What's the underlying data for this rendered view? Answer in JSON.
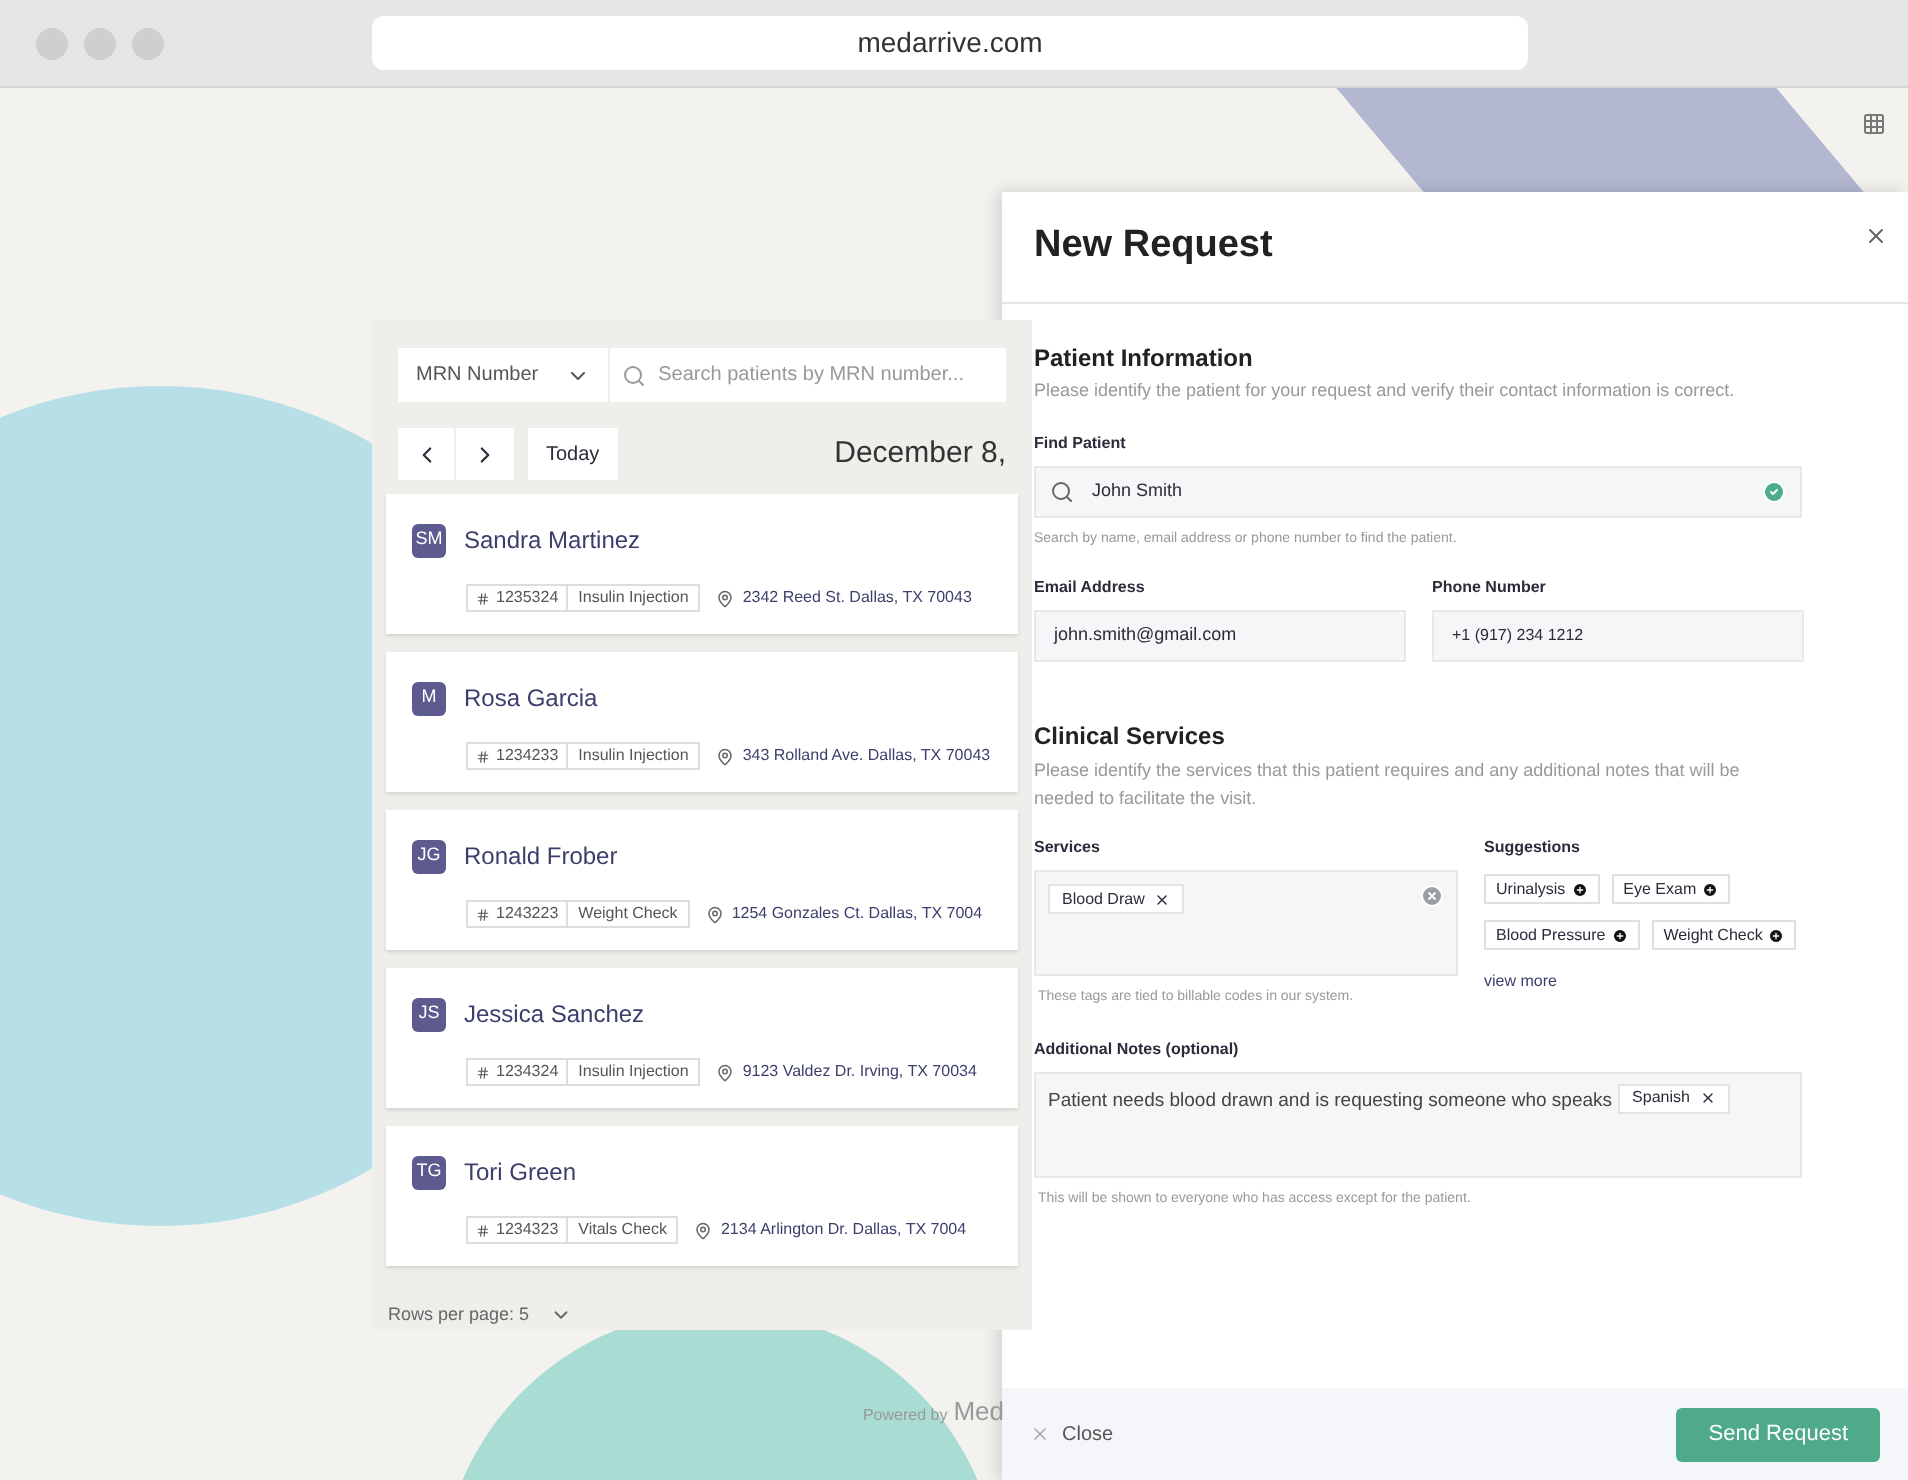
{
  "browser": {
    "url": "medarrive.com"
  },
  "list": {
    "filter": "MRN Number",
    "search_placeholder": "Search patients by MRN number...",
    "today": "Today",
    "date": "December 8,",
    "patients": [
      {
        "initials": "SM",
        "name": "Sandra Martinez",
        "mrn": "1235324",
        "service": "Insulin Injection",
        "address": "2342 Reed St. Dallas, TX 70043"
      },
      {
        "initials": "M",
        "name": "Rosa Garcia",
        "mrn": "1234233",
        "service": "Insulin Injection",
        "address": "343 Rolland Ave. Dallas, TX 70043"
      },
      {
        "initials": "JG",
        "name": "Ronald Frober",
        "mrn": "1243223",
        "service": "Weight Check",
        "address": "1254 Gonzales Ct. Dallas, TX 7004"
      },
      {
        "initials": "JS",
        "name": "Jessica Sanchez",
        "mrn": "1234324",
        "service": "Insulin Injection",
        "address": "9123 Valdez Dr. Irving, TX 70034"
      },
      {
        "initials": "TG",
        "name": "Tori Green",
        "mrn": "1234323",
        "service": "Vitals Check",
        "address": "2134 Arlington Dr. Dallas, TX 7004"
      }
    ],
    "rows_per_page": "Rows per page: 5",
    "powered_by": "Powered by",
    "brand": "Med"
  },
  "drawer": {
    "title": "New Request",
    "patient": {
      "heading": "Patient Information",
      "description": "Please identify the patient for your request and verify their contact information is correct.",
      "find_label": "Find Patient",
      "find_value": "John Smith",
      "verified": true,
      "find_hint": "Search by name, email address or phone number to find the patient.",
      "email_label": "Email Address",
      "email": "john.smith@gmail.com",
      "phone_label": "Phone Number",
      "phone": "+1 (917) 234 1212"
    },
    "clinical": {
      "heading": "Clinical Services",
      "description": "Please identify the services that this patient requires and any additional notes that will be needed to facilitate the visit.",
      "services_label": "Services",
      "services": [
        "Blood Draw"
      ],
      "services_hint": "These tags are tied to billable codes in our system.",
      "suggestions_label": "Suggestions",
      "suggestions": [
        "Urinalysis",
        "Eye Exam",
        "Blood Pressure",
        "Weight Check"
      ],
      "view_more": "view more",
      "notes_label": "Additional Notes (optional)",
      "notes": "Patient needs blood drawn and is requesting someone who speaks",
      "notes_tag": "Spanish",
      "notes_hint": "This will be shown to everyone who has access except for the patient."
    },
    "close": "Close",
    "send": "Send Request"
  }
}
